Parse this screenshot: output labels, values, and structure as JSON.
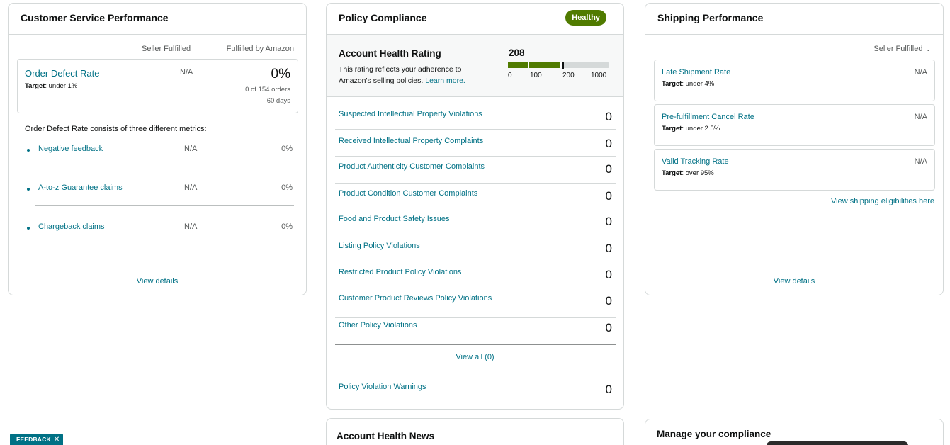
{
  "customer_service": {
    "title": "Customer Service Performance",
    "col_seller": "Seller Fulfilled",
    "col_amazon": "Fulfilled by Amazon",
    "odr": {
      "label": "Order Defect Rate",
      "target_label": "Target",
      "target_value": ": under 1%",
      "seller_value": "N/A",
      "amazon_value": "0%",
      "orders": "0 of 154 orders",
      "period": "60 days"
    },
    "description": "Order Defect Rate consists of three different metrics:",
    "metrics": [
      {
        "label": "Negative feedback",
        "seller": "N/A",
        "amazon": "0%"
      },
      {
        "label": "A-to-z Guarantee claims",
        "seller": "N/A",
        "amazon": "0%"
      },
      {
        "label": "Chargeback claims",
        "seller": "N/A",
        "amazon": "0%"
      }
    ],
    "view_details": "View details"
  },
  "policy_compliance": {
    "title": "Policy Compliance",
    "status_badge": "Healthy",
    "status_color": "#507b00",
    "ahr": {
      "title": "Account Health Rating",
      "description": "This rating reflects your adherence to Amazon's selling policies.",
      "learn_more": "Learn more.",
      "score": "208",
      "score_value": 208,
      "scale_labels": [
        "0",
        "100",
        "200",
        "1000"
      ]
    },
    "violations": [
      {
        "label": "Suspected Intellectual Property Violations",
        "count": "0"
      },
      {
        "label": "Received Intellectual Property Complaints",
        "count": "0"
      },
      {
        "label": "Product Authenticity Customer Complaints",
        "count": "0"
      },
      {
        "label": "Product Condition Customer Complaints",
        "count": "0"
      },
      {
        "label": "Food and Product Safety Issues",
        "count": "0"
      },
      {
        "label": "Listing Policy Violations",
        "count": "0"
      },
      {
        "label": "Restricted Product Policy Violations",
        "count": "0"
      },
      {
        "label": "Customer Product Reviews Policy Violations",
        "count": "0"
      },
      {
        "label": "Other Policy Violations",
        "count": "0"
      }
    ],
    "view_all": "View all (0)",
    "warnings": {
      "label": "Policy Violation Warnings",
      "count": "0"
    }
  },
  "shipping": {
    "title": "Shipping Performance",
    "fulfillment_filter": "Seller Fulfilled",
    "filter_icon": "chevron-down-icon",
    "metrics": [
      {
        "label": "Late Shipment Rate",
        "target_label": "Target",
        "target_value": ": under 4%",
        "value": "N/A"
      },
      {
        "label": "Pre-fulfillment Cancel Rate",
        "target_label": "Target",
        "target_value": ": under 2.5%",
        "value": "N/A"
      },
      {
        "label": "Valid Tracking Rate",
        "target_label": "Target",
        "target_value": ": over 95%",
        "value": "N/A"
      }
    ],
    "eligibility_link": "View shipping eligibilities here",
    "view_details": "View details"
  },
  "news": {
    "title": "Account Health News"
  },
  "manage": {
    "title": "Manage your compliance"
  },
  "feedback": {
    "label": "FEEDBACK",
    "close": "✕"
  },
  "accent_color": "#007185"
}
